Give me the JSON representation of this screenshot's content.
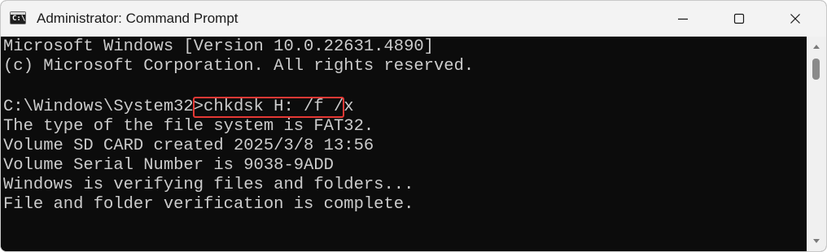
{
  "window": {
    "title": "Administrator: Command Prompt",
    "icon": "command-prompt-icon",
    "icon_glyph": "C:\\",
    "controls": [
      "minimize-icon",
      "maximize-icon",
      "close-icon"
    ]
  },
  "console": {
    "lines": [
      "Microsoft Windows [Version 10.0.22631.4890]",
      "(c) Microsoft Corporation. All rights reserved.",
      "",
      "C:\\Windows\\System32>chkdsk H: /f /x",
      "The type of the file system is FAT32.",
      "Volume SD CARD created 2025/3/8 13:56",
      "Volume Serial Number is 9038-9ADD",
      "Windows is verifying files and folders...",
      "File and folder verification is complete."
    ],
    "highlighted_command": "chkdsk H: /f /x",
    "highlight_color": "#e53935",
    "text_color": "#cccccc",
    "background_color": "#0c0c0c"
  }
}
